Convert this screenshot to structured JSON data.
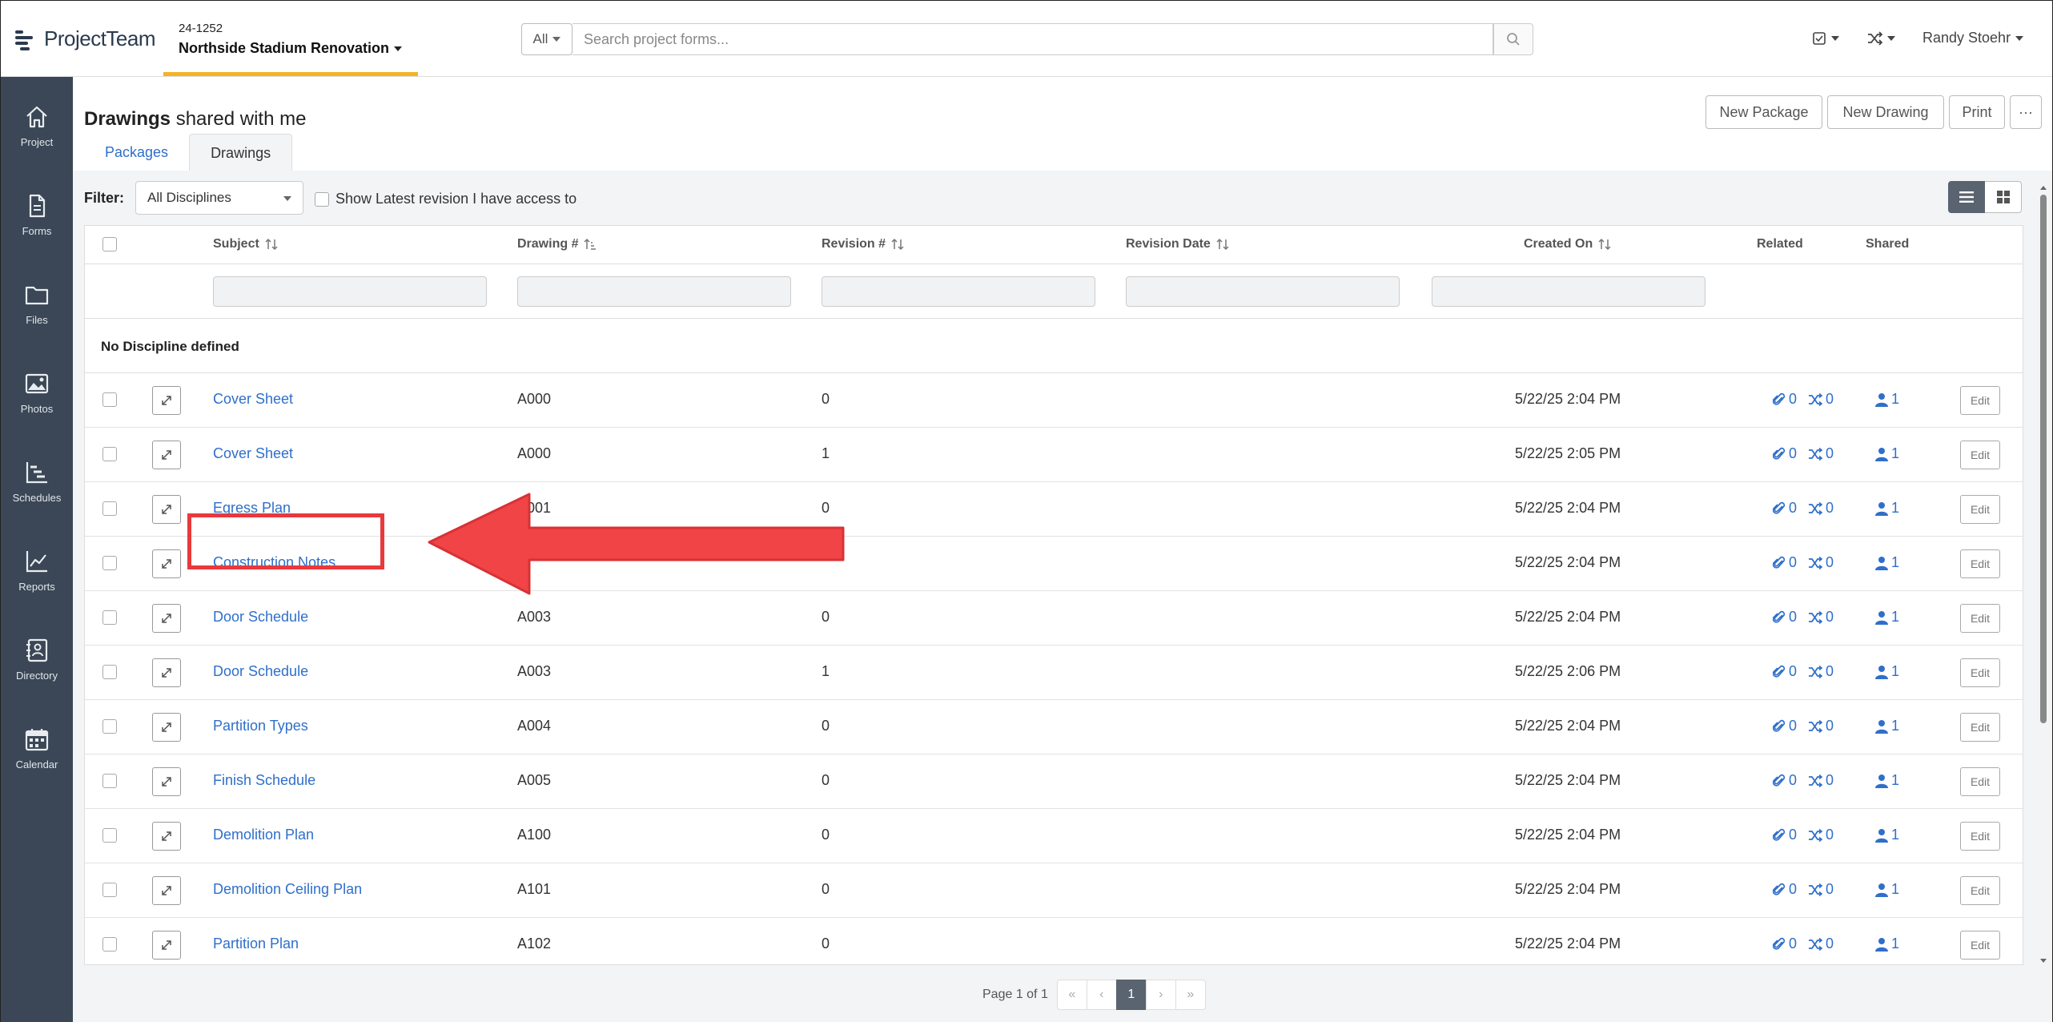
{
  "app": {
    "logo_bold": "Project",
    "logo_rest": "Team",
    "project_number": "24-1252",
    "project_name": "Northside Stadium Renovation",
    "search_scope": "All",
    "search_placeholder": "Search project forms...",
    "user_name": "Randy Stoehr"
  },
  "sidebar": {
    "items": [
      {
        "label": "Project",
        "icon": "home-icon"
      },
      {
        "label": "Forms",
        "icon": "document-icon"
      },
      {
        "label": "Files",
        "icon": "folder-icon"
      },
      {
        "label": "Photos",
        "icon": "image-icon"
      },
      {
        "label": "Schedules",
        "icon": "schedule-icon"
      },
      {
        "label": "Reports",
        "icon": "chart-line-icon"
      },
      {
        "label": "Directory",
        "icon": "contact-card-icon"
      },
      {
        "label": "Calendar",
        "icon": "calendar-icon"
      }
    ]
  },
  "page": {
    "title_bold": "Drawings",
    "title_rest": " shared with me",
    "tabs": [
      "Packages",
      "Drawings"
    ],
    "active_tab": "Drawings",
    "buttons": {
      "new_package": "New Package",
      "new_drawing": "New Drawing",
      "print": "Print",
      "more": "···"
    }
  },
  "filter": {
    "label": "Filter:",
    "discipline_value": "All Disciplines",
    "latest_revision_label": "Show Latest revision I have access to"
  },
  "table": {
    "columns": {
      "subject": "Subject",
      "drawing_num": "Drawing #",
      "revision_num": "Revision #",
      "revision_date": "Revision Date",
      "created_on": "Created On",
      "related": "Related",
      "shared": "Shared"
    },
    "group_label": "No Discipline defined",
    "edit_label": "Edit",
    "rows": [
      {
        "subject": "Cover Sheet",
        "drawing": "A000",
        "revision": "0",
        "created": "5/22/25 2:04 PM",
        "attachments": "0",
        "links": "0",
        "shared": "1"
      },
      {
        "subject": "Cover Sheet",
        "drawing": "A000",
        "revision": "1",
        "created": "5/22/25 2:05 PM",
        "attachments": "0",
        "links": "0",
        "shared": "1"
      },
      {
        "subject": "Egress Plan",
        "drawing": "A001",
        "revision": "0",
        "created": "5/22/25 2:04 PM",
        "attachments": "0",
        "links": "0",
        "shared": "1"
      },
      {
        "subject": "Construction Notes",
        "drawing": "",
        "revision": "",
        "created": "5/22/25 2:04 PM",
        "attachments": "0",
        "links": "0",
        "shared": "1"
      },
      {
        "subject": "Door Schedule",
        "drawing": "A003",
        "revision": "0",
        "created": "5/22/25 2:04 PM",
        "attachments": "0",
        "links": "0",
        "shared": "1"
      },
      {
        "subject": "Door Schedule",
        "drawing": "A003",
        "revision": "1",
        "created": "5/22/25 2:06 PM",
        "attachments": "0",
        "links": "0",
        "shared": "1"
      },
      {
        "subject": "Partition Types",
        "drawing": "A004",
        "revision": "0",
        "created": "5/22/25 2:04 PM",
        "attachments": "0",
        "links": "0",
        "shared": "1"
      },
      {
        "subject": "Finish Schedule",
        "drawing": "A005",
        "revision": "0",
        "created": "5/22/25 2:04 PM",
        "attachments": "0",
        "links": "0",
        "shared": "1"
      },
      {
        "subject": "Demolition Plan",
        "drawing": "A100",
        "revision": "0",
        "created": "5/22/25 2:04 PM",
        "attachments": "0",
        "links": "0",
        "shared": "1"
      },
      {
        "subject": "Demolition Ceiling Plan",
        "drawing": "A101",
        "revision": "0",
        "created": "5/22/25 2:04 PM",
        "attachments": "0",
        "links": "0",
        "shared": "1"
      },
      {
        "subject": "Partition Plan",
        "drawing": "A102",
        "revision": "0",
        "created": "5/22/25 2:04 PM",
        "attachments": "0",
        "links": "0",
        "shared": "1"
      }
    ]
  },
  "pagination": {
    "info": "Page 1 of 1",
    "current": "1",
    "first": "«",
    "prev": "‹",
    "next": "›",
    "last": "»"
  },
  "annotation": {
    "color": "#e8393c",
    "highlighted_row": "Construction Notes"
  }
}
